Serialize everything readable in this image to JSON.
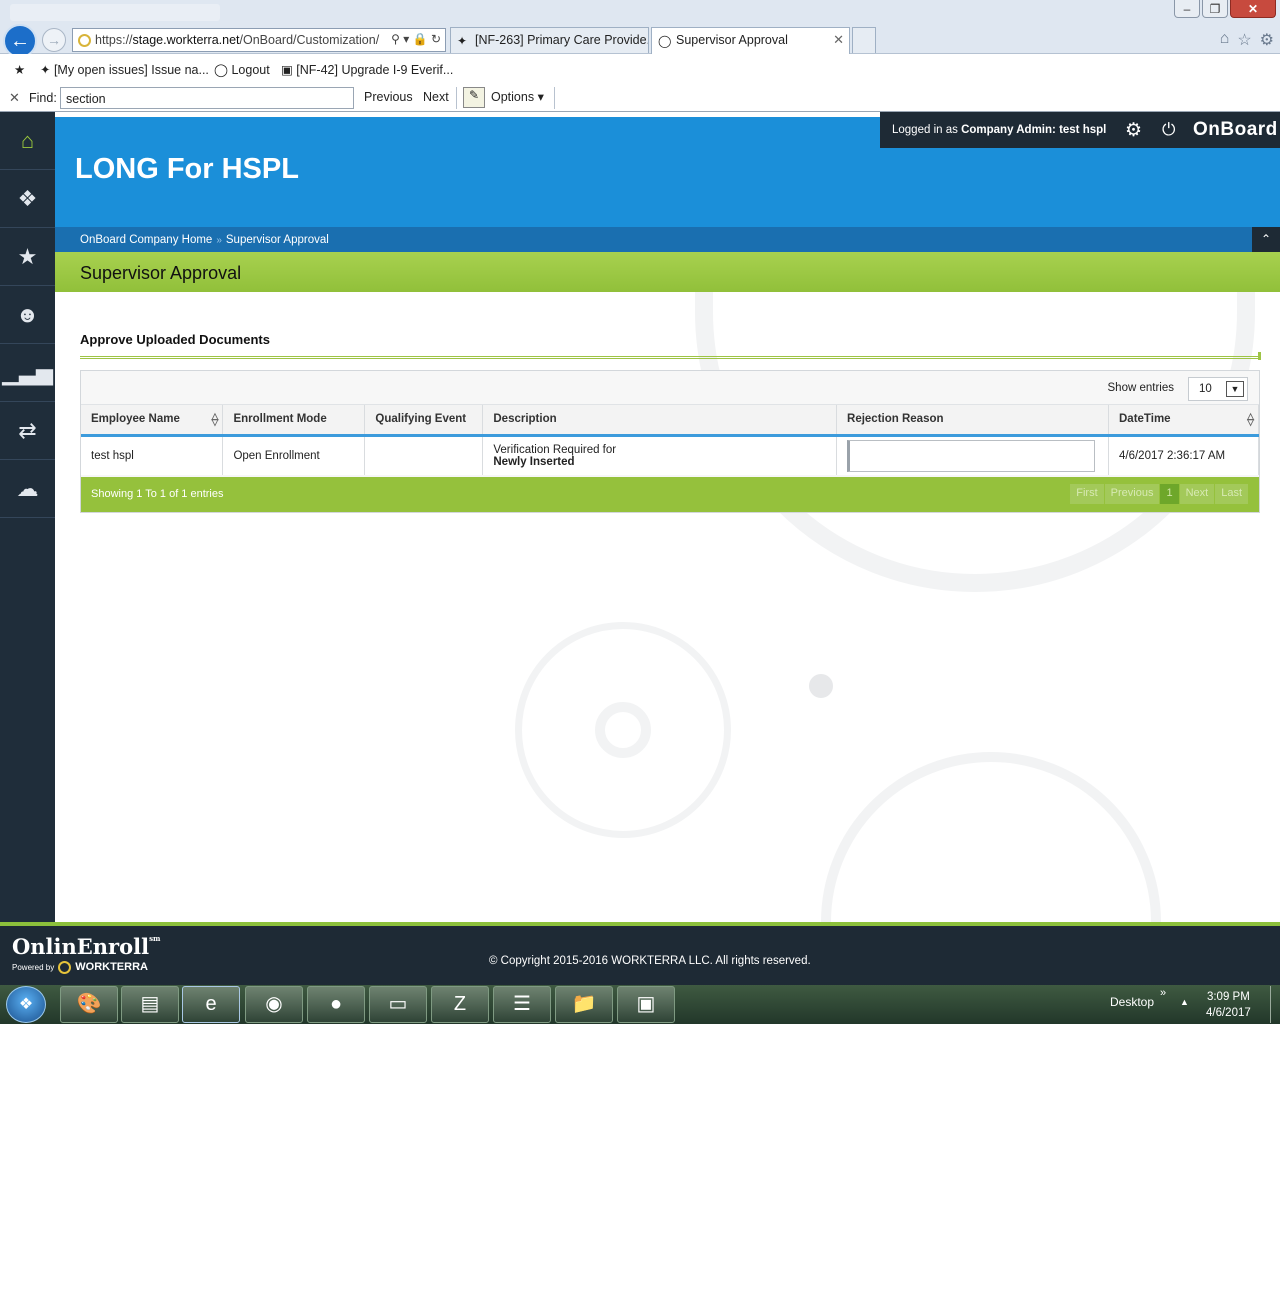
{
  "browser": {
    "url_prefix": "https://",
    "url_host": "stage.workterra.net",
    "url_path": "/OnBoard/Customization/",
    "tabs": [
      {
        "label": "[NF-263] Primary Care Provide..."
      },
      {
        "label": "Supervisor Approval"
      }
    ],
    "favorites": [
      {
        "label": "[My open issues] Issue na..."
      },
      {
        "label": "Logout"
      },
      {
        "label": "[NF-42] Upgrade I-9 Everif..."
      }
    ],
    "find": {
      "label": "Find:",
      "value": "section",
      "previous_label": "Previous",
      "next_label": "Next",
      "options_label": "Options"
    }
  },
  "app": {
    "company_name": "LONG For HSPL",
    "user": {
      "logged_in_prefix": "Logged in as",
      "role": "Company Admin:",
      "name": "test hspl"
    },
    "brand": "OnBoard",
    "breadcrumb": [
      "OnBoard Company Home",
      "Supervisor Approval"
    ],
    "page_title": "Supervisor Approval",
    "section_title": "Approve Uploaded Documents",
    "show_entries_label": "Show entries",
    "show_entries_value": "10",
    "table": {
      "columns": [
        "Employee Name",
        "Enrollment Mode",
        "Qualifying Event",
        "Description",
        "Rejection Reason",
        "DateTime"
      ],
      "rows": [
        {
          "employee_name": "test hspl",
          "enrollment_mode": "Open Enrollment",
          "qualifying_event": "",
          "description_line1": "Verification Required for",
          "description_line2": "Newly Inserted",
          "rejection_reason": "",
          "datetime": "4/6/2017 2:36:17 AM"
        }
      ]
    },
    "footer_info": "Showing 1 To 1 of 1 entries",
    "pager": {
      "first": "First",
      "previous": "Previous",
      "current": "1",
      "next": "Next",
      "last": "Last"
    }
  },
  "footer": {
    "logo_text": "OnlinEnroll",
    "logo_mark": "sm",
    "powered_by": "Powered by",
    "powered_brand": "WORKTERRA",
    "copyright": "© Copyright 2015-2016 WORKTERRA LLC. All rights reserved."
  },
  "taskbar": {
    "desktop_label": "Desktop",
    "time": "3:09 PM",
    "date": "4/6/2017"
  },
  "colors": {
    "header_blue": "#1b8fd9",
    "crumb_blue": "#1a6fb0",
    "accent_green": "#95c13c",
    "sidebar_dark": "#1f2d3a"
  }
}
